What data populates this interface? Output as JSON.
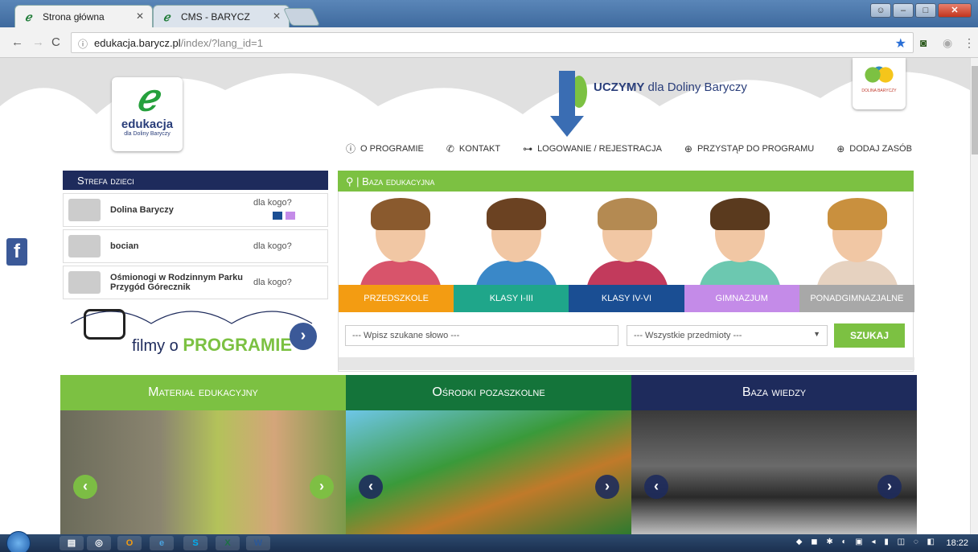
{
  "browser": {
    "tabs": [
      {
        "title": "Strona główna",
        "favicon": "edukacja-e-icon"
      },
      {
        "title": "CMS - BARYCZ",
        "favicon": "edukacja-e-icon"
      }
    ],
    "address": {
      "host": "edukacja.barycz.pl",
      "path": "/index/?lang_id=1"
    }
  },
  "header": {
    "logo_name": "edukacja",
    "logo_sub": "dla Doliny Baryczy",
    "tagline_bold": "UCZYMY",
    "tagline_rest": "dla Doliny Baryczy",
    "partner_logo_text": "DOLINA BARYCZY",
    "nav": [
      {
        "label": "O PROGRAMIE",
        "icon": "info-icon"
      },
      {
        "label": "KONTAKT",
        "icon": "phone-icon"
      },
      {
        "label": "LOGOWANIE / REJESTRACJA",
        "icon": "key-icon"
      },
      {
        "label": "PRZYSTĄP DO PROGRAMU",
        "icon": "plus-filled-icon"
      },
      {
        "label": "DODAJ ZASÓB",
        "icon": "plus-circle-icon"
      }
    ]
  },
  "strefa": {
    "title": "Strefa dzieci",
    "items": [
      {
        "label": "Dolina Baryczy",
        "dla": "dla kogo?"
      },
      {
        "label": "bocian",
        "dla": "dla kogo?"
      },
      {
        "label": "Ośmionogi w Rodzinnym Parku Przygód Górecznik",
        "dla": "dla kogo?"
      }
    ],
    "filmy_text": "filmy o",
    "filmy_bold": "PROGRAMIE"
  },
  "baza": {
    "title": "Baza edukacyjna",
    "levels": [
      {
        "label": "PRZEDSZKOLE",
        "color": "#f39c12"
      },
      {
        "label": "KLASY I-III",
        "color": "#1fa68a"
      },
      {
        "label": "KLASY IV-VI",
        "color": "#1a4e93"
      },
      {
        "label": "GIMNAZJUM",
        "color": "#c48be8"
      },
      {
        "label": "PONADGIMNAZJALNE",
        "color": "#a8a8a8"
      }
    ],
    "search_placeholder": "--- Wpisz szukane słowo ---",
    "select_value": "--- Wszystkie przedmioty ---",
    "search_button": "SZUKAJ"
  },
  "panels": [
    {
      "title": "Materiał edukacyjny",
      "color": "#7cc142"
    },
    {
      "title": "Ośrodki pozaszkolne",
      "color": "#14743a"
    },
    {
      "title": "Baza wiedzy",
      "color": "#1e2b5c"
    }
  ],
  "taskbar": {
    "clock": "18:22"
  },
  "colors": {
    "brand_green": "#7cc142",
    "brand_navy": "#1e2b5c",
    "annotation_arrow": "#3a6db3"
  }
}
